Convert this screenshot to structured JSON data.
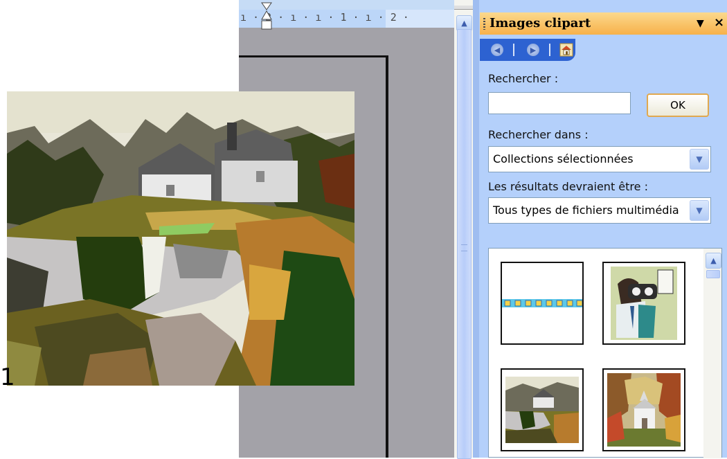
{
  "ruler": {
    "text": "ı · 2 · ı · ı · 1 · ı · 2 ·"
  },
  "document": {
    "trailing_char": "1"
  },
  "task_pane": {
    "title": "Images clipart",
    "menu_glyph": "▼",
    "close_glyph": "×",
    "nav": {
      "back_glyph": "◀",
      "forward_glyph": "▶",
      "home_glyph": "⌂"
    },
    "search": {
      "label": "Rechercher :",
      "value": "",
      "ok_label": "OK"
    },
    "search_in": {
      "label": "Rechercher dans :",
      "selected": "Collections sélectionnées"
    },
    "results_type": {
      "label": "Les résultats devraient être :",
      "selected": "Tous types de fichiers multimédia"
    },
    "thumbnails": [
      {
        "name": "colored-squares-border"
      },
      {
        "name": "optometrist-eye-exam"
      },
      {
        "name": "lakeside-cottage"
      },
      {
        "name": "church-in-autumn-trees"
      }
    ]
  },
  "colors": {
    "pane_bg": "#b4d0fb",
    "title_bar": "#f7b14a",
    "nav_bar": "#2d62d1",
    "doc_gray": "#a3a2a8"
  },
  "icons": [
    "back-icon",
    "forward-icon",
    "home-icon",
    "dropdown-arrow-icon",
    "close-icon",
    "scroll-up-icon",
    "menu-arrow-icon"
  ]
}
